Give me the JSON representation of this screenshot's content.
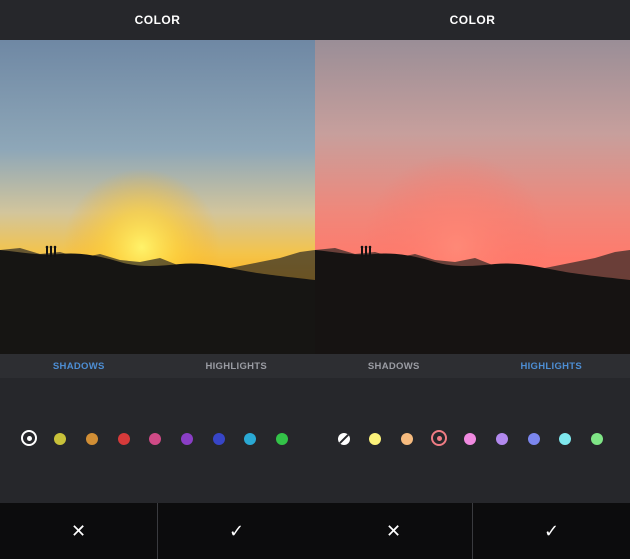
{
  "left": {
    "title": "COLOR",
    "tabs": [
      {
        "label": "SHADOWS",
        "active": true
      },
      {
        "label": "HIGHLIGHTS",
        "active": false
      }
    ],
    "swatches": [
      "#ffffff",
      "#c8c13a",
      "#d18e35",
      "#d63a3a",
      "#cf4a86",
      "#8a3ec6",
      "#3745c7",
      "#2aa9d4",
      "#33c348"
    ],
    "selected_swatch": 0,
    "cancel_glyph": "✕",
    "confirm_glyph": "✓"
  },
  "right": {
    "title": "COLOR",
    "tabs": [
      {
        "label": "SHADOWS",
        "active": false
      },
      {
        "label": "HIGHLIGHTS",
        "active": true
      }
    ],
    "swatches": [
      "#ffffff",
      "#fcf27a",
      "#f6bb7f",
      "#f07c84",
      "#f08ae0",
      "#b289ee",
      "#7b86ee",
      "#7fe8ee",
      "#7fe586"
    ],
    "selected_swatch": 3,
    "cancel_glyph": "✕",
    "confirm_glyph": "✓"
  },
  "colors": {
    "accent": "#4d8ed4",
    "background": "#26272b",
    "bottom_bar": "#0c0c0d"
  },
  "icons": {
    "selected": "ring-dot-icon",
    "none": "slash-circle-icon",
    "cancel": "close-icon",
    "confirm": "checkmark-icon"
  }
}
